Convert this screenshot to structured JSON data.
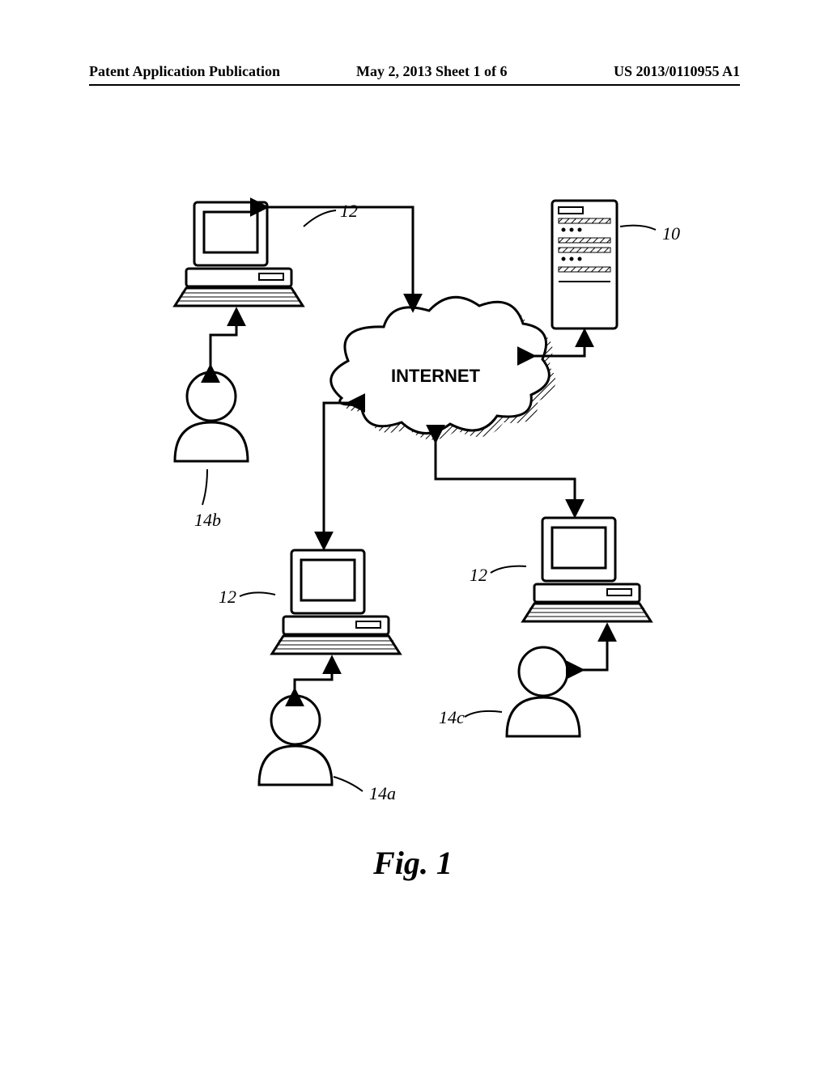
{
  "header": {
    "left": "Patent Application Publication",
    "middle": "May 2, 2013  Sheet 1 of 6",
    "right": "US 2013/0110955 A1"
  },
  "diagram": {
    "cloud_label": "INTERNET",
    "figure_caption": "Fig. 1",
    "nodes": {
      "server": {
        "ref": "10"
      },
      "computer_top": {
        "ref": "12"
      },
      "computer_mid": {
        "ref": "12"
      },
      "computer_right": {
        "ref": "12"
      },
      "user_a": {
        "ref": "14a"
      },
      "user_b": {
        "ref": "14b"
      },
      "user_c": {
        "ref": "14c"
      }
    }
  }
}
